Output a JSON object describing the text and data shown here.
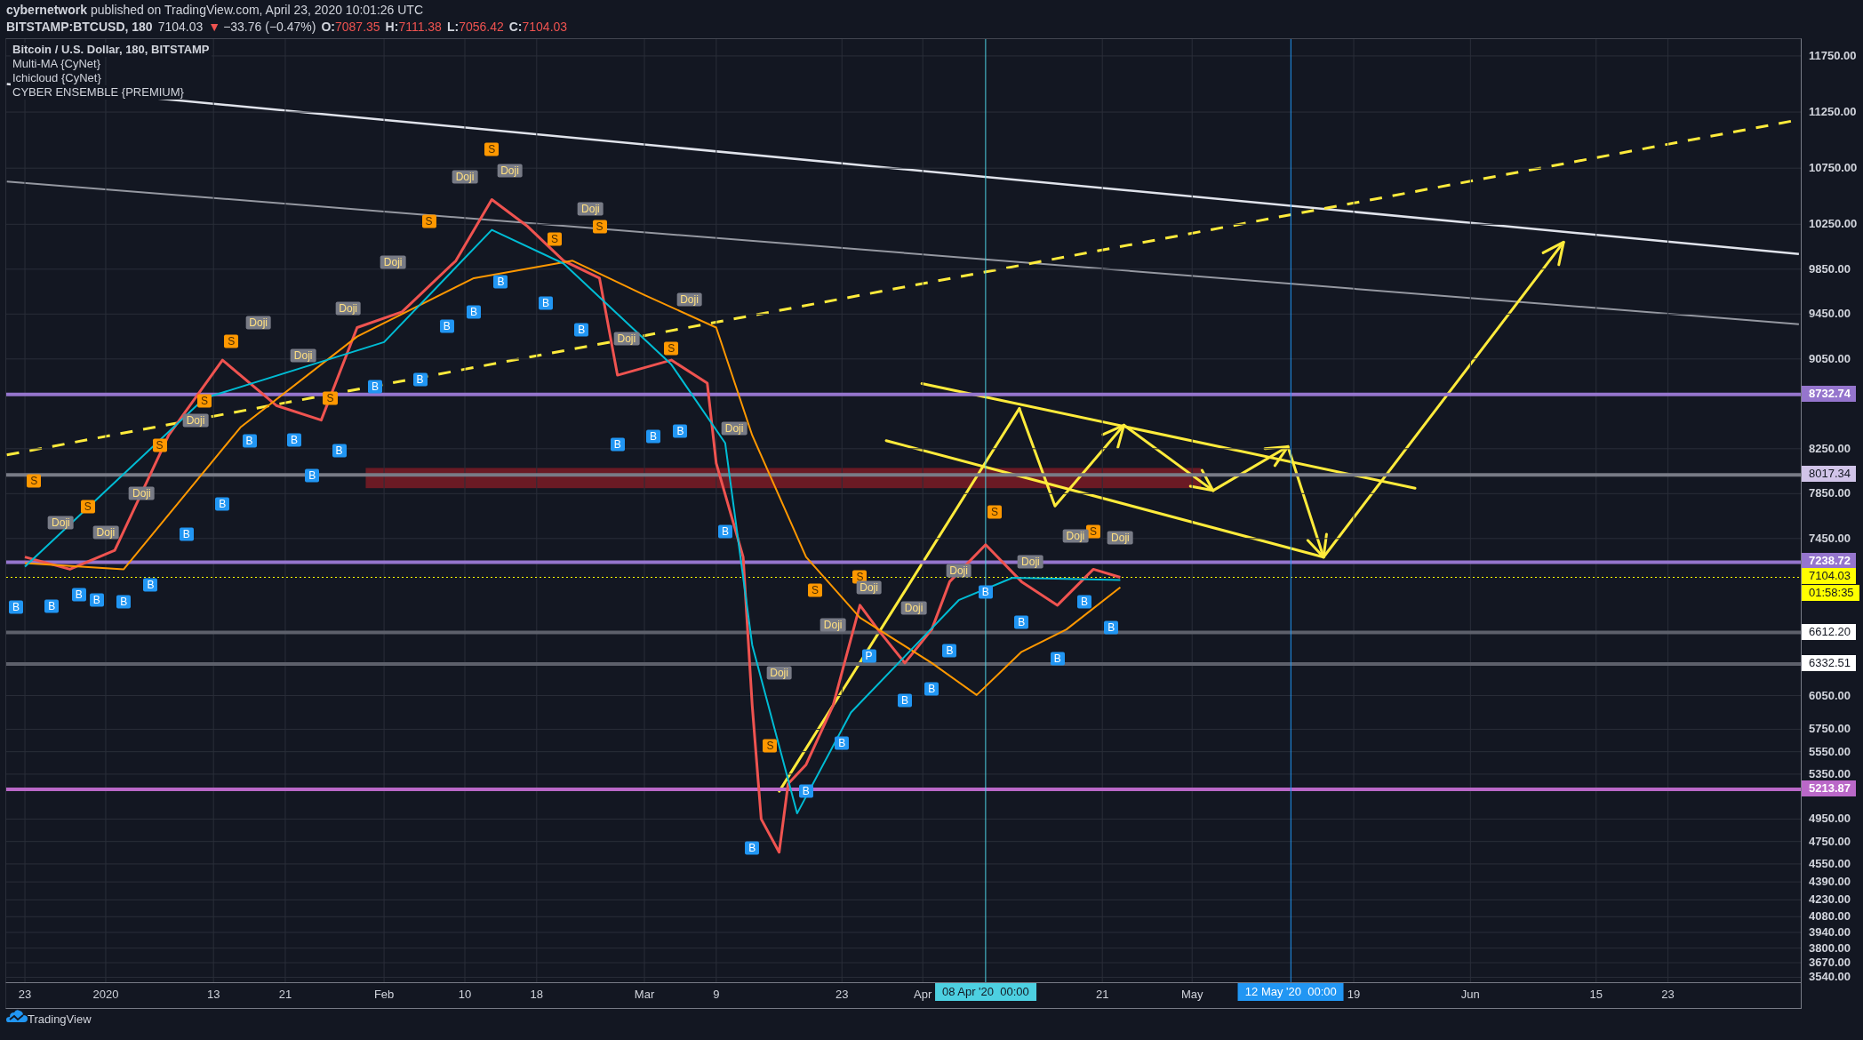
{
  "header": {
    "publication": "**cybernetwork** published on TradingView.com, April 23, 2020 10:01:26 UTC",
    "quote": {
      "symbol": "BITSTAMP:BTCUSD, 180",
      "last": "7104.03",
      "arrow": "▼",
      "change": "−33.76 (−0.47%)",
      "ohlc": [
        {
          "label": "O:",
          "value": "7087.35"
        },
        {
          "label": "H:",
          "value": "7111.38"
        },
        {
          "label": "L:",
          "value": "7056.42"
        },
        {
          "label": "C:",
          "value": "7104.03"
        }
      ]
    }
  },
  "chart": {
    "legend": [
      "Bitcoin / U.S. Dollar, 180, BITSTAMP",
      "Multi-MA {CyNet}",
      "Ichicloud {CyNet}",
      "CYBER ENSEMBLE {PREMIUM}"
    ],
    "countdown": "01:58:35",
    "signals": [
      {
        "kind": "sell",
        "text": "S"
      },
      {
        "kind": "sell",
        "text": "S"
      },
      {
        "kind": "sell",
        "text": "S"
      },
      {
        "kind": "sell",
        "text": "S"
      },
      {
        "kind": "sell",
        "text": "S"
      },
      {
        "kind": "sell",
        "text": "S"
      },
      {
        "kind": "sell",
        "text": "S"
      },
      {
        "kind": "sell",
        "text": "S"
      },
      {
        "kind": "sell",
        "text": "S"
      },
      {
        "kind": "sell",
        "text": "S"
      },
      {
        "kind": "sell",
        "text": "S"
      },
      {
        "kind": "sell",
        "text": "S"
      },
      {
        "kind": "sell",
        "text": "S"
      },
      {
        "kind": "sell",
        "text": "S"
      },
      {
        "kind": "sell",
        "text": "S"
      },
      {
        "kind": "sell",
        "text": "S"
      },
      {
        "kind": "doji",
        "text": "Doji"
      },
      {
        "kind": "doji",
        "text": "Doji"
      },
      {
        "kind": "doji",
        "text": "Doji"
      },
      {
        "kind": "doji",
        "text": "Doji"
      },
      {
        "kind": "doji",
        "text": "Doji"
      },
      {
        "kind": "doji",
        "text": "Doji"
      },
      {
        "kind": "doji",
        "text": "Doji"
      },
      {
        "kind": "doji",
        "text": "Doji"
      },
      {
        "kind": "doji",
        "text": "Doji"
      },
      {
        "kind": "doji",
        "text": "Doji"
      },
      {
        "kind": "doji",
        "text": "Doji"
      },
      {
        "kind": "doji",
        "text": "Doji"
      },
      {
        "kind": "doji",
        "text": "Doji"
      },
      {
        "kind": "doji",
        "text": "Doji"
      },
      {
        "kind": "doji",
        "text": "Doji"
      },
      {
        "kind": "doji",
        "text": "Doji"
      },
      {
        "kind": "doji",
        "text": "Doji"
      },
      {
        "kind": "doji",
        "text": "Doji"
      },
      {
        "kind": "doji",
        "text": "Doji"
      },
      {
        "kind": "doji",
        "text": "Doji"
      },
      {
        "kind": "doji",
        "text": "Doji"
      },
      {
        "kind": "doji",
        "text": "Doji"
      },
      {
        "kind": "buy",
        "text": "B"
      },
      {
        "kind": "buy",
        "text": "B"
      },
      {
        "kind": "buy",
        "text": "B"
      },
      {
        "kind": "buy",
        "text": "B"
      },
      {
        "kind": "buy",
        "text": "B"
      },
      {
        "kind": "buy",
        "text": "B"
      },
      {
        "kind": "buy",
        "text": "B"
      },
      {
        "kind": "buy",
        "text": "B"
      },
      {
        "kind": "buy",
        "text": "B"
      },
      {
        "kind": "buy",
        "text": "B"
      },
      {
        "kind": "buy",
        "text": "B"
      },
      {
        "kind": "buy",
        "text": "B"
      },
      {
        "kind": "buy",
        "text": "B"
      },
      {
        "kind": "buy",
        "text": "B"
      },
      {
        "kind": "buy",
        "text": "B"
      },
      {
        "kind": "buy",
        "text": "B"
      },
      {
        "kind": "buy",
        "text": "B"
      },
      {
        "kind": "buy",
        "text": "B"
      },
      {
        "kind": "buy",
        "text": "B"
      },
      {
        "kind": "buy",
        "text": "B"
      },
      {
        "kind": "buy",
        "text": "B"
      },
      {
        "kind": "buy",
        "text": "B"
      },
      {
        "kind": "buy",
        "text": "B"
      },
      {
        "kind": "buy",
        "text": "B"
      },
      {
        "kind": "buy",
        "text": "B"
      },
      {
        "kind": "buy",
        "text": "B"
      },
      {
        "kind": "pattern",
        "text": "P"
      },
      {
        "kind": "buy",
        "text": "B"
      },
      {
        "kind": "buy",
        "text": "B"
      },
      {
        "kind": "buy",
        "text": "B"
      },
      {
        "kind": "buy",
        "text": "B"
      },
      {
        "kind": "buy",
        "text": "B"
      },
      {
        "kind": "buy",
        "text": "B"
      },
      {
        "kind": "buy",
        "text": "B"
      },
      {
        "kind": "buy",
        "text": "B"
      }
    ],
    "chart_data": {
      "type": "line",
      "grid": true,
      "xlim": [
        "2019-12-20T22:00",
        "2020-07-07T19:00"
      ],
      "ylim": [
        3496,
        11900
      ],
      "series": [
        {
          "color": "#ef5350",
          "x": [
            "2019-12-23",
            "2019-12-28",
            "2020-01-02",
            "2020-01-08",
            "2020-01-14",
            "2020-01-20",
            "2020-01-25",
            "2020-01-29",
            "2020-02-03",
            "2020-02-09",
            "2020-02-13",
            "2020-02-17",
            "2020-02-21",
            "2020-02-25",
            "2020-02-27",
            "2020-03-04",
            "2020-03-08",
            "2020-03-09",
            "2020-03-12",
            "2020-03-13",
            "2020-03-14",
            "2020-03-16",
            "2020-03-17",
            "2020-03-19",
            "2020-03-22",
            "2020-03-25",
            "2020-03-27",
            "2020-03-30",
            "2020-04-02",
            "2020-04-04",
            "2020-04-08",
            "2020-04-12",
            "2020-04-16",
            "2020-04-20",
            "2020-04-23"
          ],
          "values": [
            7285,
            7176,
            7344,
            8370,
            9040,
            8635,
            8505,
            9330,
            9470,
            9925,
            10470,
            10230,
            9925,
            9770,
            8905,
            9040,
            8835,
            8120,
            7285,
            5960,
            4950,
            4655,
            5265,
            5435,
            5960,
            6855,
            6640,
            6340,
            6640,
            7065,
            7395,
            7065,
            6855,
            7176,
            7104
          ]
        },
        {
          "color": "#ff9800",
          "x": [
            "2019-12-23",
            "2020-01-03",
            "2020-01-16",
            "2020-01-29",
            "2020-02-11",
            "2020-02-22",
            "2020-03-01",
            "2020-03-09",
            "2020-03-13",
            "2020-03-19",
            "2020-03-25",
            "2020-04-02",
            "2020-04-07",
            "2020-04-12",
            "2020-04-17",
            "2020-04-23"
          ],
          "values": [
            7230,
            7176,
            8440,
            9250,
            9770,
            9925,
            9620,
            9330,
            8370,
            7285,
            6745,
            6340,
            6055,
            6440,
            6640,
            7015
          ]
        },
        {
          "color": "#00bcd4",
          "x": [
            "2019-12-23",
            "2020-01-12",
            "2020-02-01",
            "2020-02-13",
            "2020-02-21",
            "2020-03-04",
            "2020-03-10",
            "2020-03-13",
            "2020-03-18",
            "2020-03-24",
            "2020-03-30",
            "2020-04-05",
            "2020-04-11",
            "2020-04-23"
          ],
          "values": [
            7200,
            8700,
            9200,
            10200,
            9900,
            9000,
            8300,
            6500,
            5000,
            5900,
            6400,
            6900,
            7100,
            7080
          ]
        }
      ],
      "yticks": [
        {
          "value": 11750,
          "label": "11750.00"
        },
        {
          "value": 11250,
          "label": "11250.00"
        },
        {
          "value": 10750,
          "label": "10750.00"
        },
        {
          "value": 10250,
          "label": "10250.00"
        },
        {
          "value": 9850,
          "label": "9850.00"
        },
        {
          "value": 9450,
          "label": "9450.00"
        },
        {
          "value": 9050,
          "label": "9050.00"
        },
        {
          "value": 8250,
          "label": "8250.00"
        },
        {
          "value": 7850,
          "label": "7850.00"
        },
        {
          "value": 7450,
          "label": "7450.00"
        },
        {
          "value": 6050,
          "label": "6050.00"
        },
        {
          "value": 5750,
          "label": "5750.00"
        },
        {
          "value": 5550,
          "label": "5550.00"
        },
        {
          "value": 5350,
          "label": "5350.00"
        },
        {
          "value": 4950,
          "label": "4950.00"
        },
        {
          "value": 4750,
          "label": "4750.00"
        },
        {
          "value": 4550,
          "label": "4550.00"
        },
        {
          "value": 4390,
          "label": "4390.00"
        },
        {
          "value": 4230,
          "label": "4230.00"
        },
        {
          "value": 4080,
          "label": "4080.00"
        },
        {
          "value": 3940,
          "label": "3940.00"
        },
        {
          "value": 3800,
          "label": "3800.00"
        },
        {
          "value": 3670,
          "label": "3670.00"
        },
        {
          "value": 3540,
          "label": "3540.00"
        }
      ],
      "xticks": [
        {
          "value": "2019-12-23",
          "label": "23"
        },
        {
          "value": "2020-01-01",
          "label": "2020"
        },
        {
          "value": "2020-01-13",
          "label": "13"
        },
        {
          "value": "2020-01-21",
          "label": "21"
        },
        {
          "value": "2020-02-01",
          "label": "Feb"
        },
        {
          "value": "2020-02-10",
          "label": "10"
        },
        {
          "value": "2020-02-18",
          "label": "18"
        },
        {
          "value": "2020-03-01",
          "label": "Mar"
        },
        {
          "value": "2020-03-09",
          "label": "9"
        },
        {
          "value": "2020-03-23",
          "label": "23"
        },
        {
          "value": "2020-04-01",
          "label": "Apr"
        },
        {
          "value": "2020-04-21",
          "label": "21"
        },
        {
          "value": "2020-05-01",
          "label": "May"
        },
        {
          "value": "2020-05-19",
          "label": "19"
        },
        {
          "value": "2020-06-01",
          "label": "Jun"
        },
        {
          "value": "2020-06-15",
          "label": "15"
        },
        {
          "value": "2020-06-23",
          "label": "23"
        }
      ],
      "ref_lines": [
        {
          "axis": "y",
          "value": 8732.74,
          "label": "8732.74",
          "color": "#9575cd"
        },
        {
          "axis": "y",
          "value": 8017.34,
          "label": "8017.34",
          "color": "#787b86"
        },
        {
          "axis": "y",
          "value": 7238.72,
          "label": "7238.72",
          "color": "#9575cd"
        },
        {
          "axis": "y",
          "value": 7104.03,
          "label": "7104.03",
          "color": "#ffff00"
        },
        {
          "axis": "y",
          "value": 6612.2,
          "label": "6612.20",
          "color": "#5d606b"
        },
        {
          "axis": "y",
          "value": 6332.51,
          "label": "6332.51",
          "color": "#5d606b"
        },
        {
          "axis": "y",
          "value": 5213.87,
          "label": "5213.87",
          "color": "#ba68c8"
        },
        {
          "axis": "x",
          "value": "2020-04-08",
          "label": "08 Apr '20  00:00",
          "color": "#4dd0e1"
        },
        {
          "axis": "x",
          "value": "2020-05-12",
          "label": "12 May '20  00:00",
          "color": "#2196f3"
        }
      ]
    }
  },
  "footer": {
    "brand": "TradingView"
  }
}
